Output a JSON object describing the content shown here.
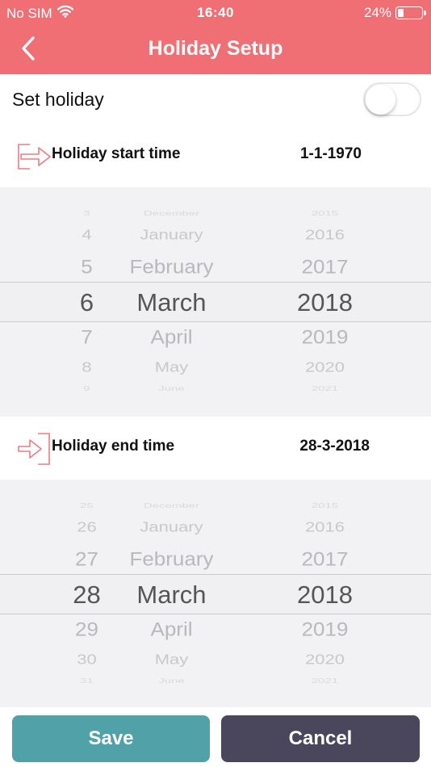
{
  "status_bar": {
    "carrier": "No SIM",
    "time": "16:40",
    "battery": "24%",
    "battery_level": 0.24,
    "wifi_icon": "wifi-icon",
    "battery_icon": "battery-icon"
  },
  "header": {
    "title": "Holiday Setup",
    "back_icon": "chevron-left-icon",
    "color": "#ef6f74"
  },
  "set_holiday": {
    "label": "Set holiday",
    "enabled": false
  },
  "start": {
    "label": "Holiday start time",
    "value": "1-1-1970",
    "icon": "login-arrow-icon",
    "picker": {
      "days": [
        "3",
        "4",
        "5",
        "6",
        "7",
        "8",
        "9"
      ],
      "months": [
        "December",
        "January",
        "February",
        "March",
        "April",
        "May",
        "June"
      ],
      "years": [
        "2015",
        "2016",
        "2017",
        "2018",
        "2019",
        "2020",
        "2021"
      ]
    }
  },
  "end": {
    "label": "Holiday end time",
    "value": "28-3-2018",
    "icon": "logout-arrow-icon",
    "picker": {
      "days": [
        "25",
        "26",
        "27",
        "28",
        "29",
        "30",
        "31"
      ],
      "months": [
        "December",
        "January",
        "February",
        "March",
        "April",
        "May",
        "June"
      ],
      "years": [
        "2015",
        "2016",
        "2017",
        "2018",
        "2019",
        "2020",
        "2021"
      ]
    }
  },
  "footer": {
    "save_label": "Save",
    "cancel_label": "Cancel",
    "save_color": "#51a1a8",
    "cancel_color": "#4a475c"
  }
}
